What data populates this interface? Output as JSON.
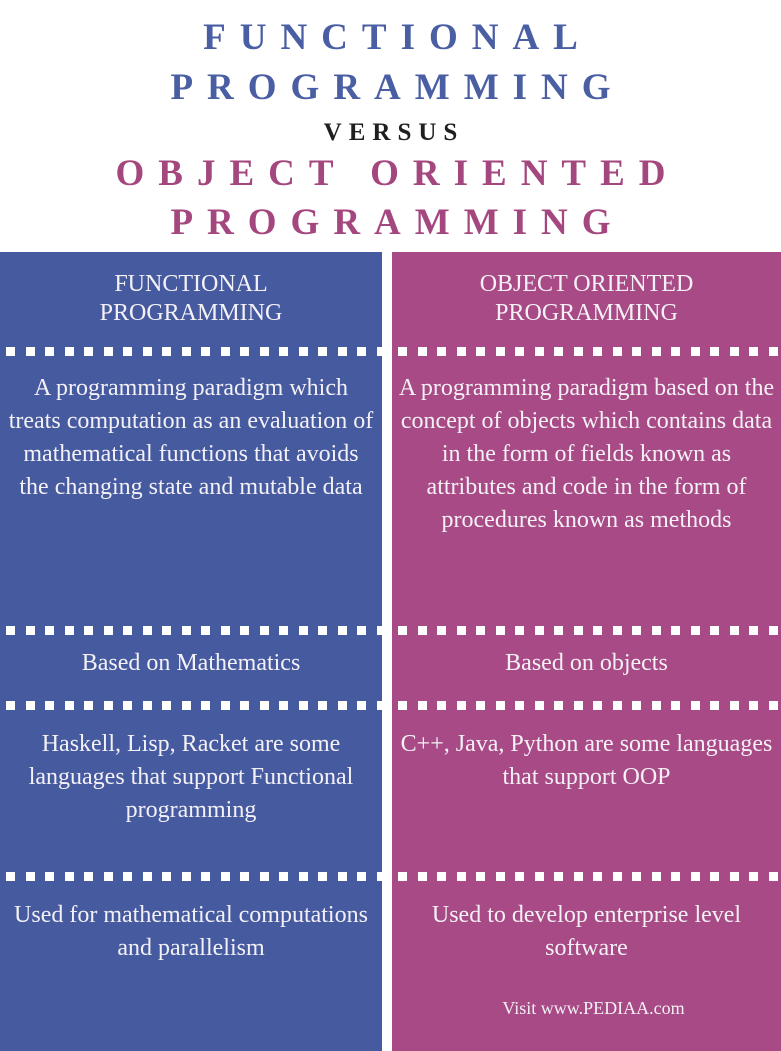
{
  "title": {
    "line1": "FUNCTIONAL",
    "line2": "PROGRAMMING",
    "versus": "VERSUS",
    "line3": "OBJECT ORIENTED",
    "line4": "PROGRAMMING"
  },
  "colors": {
    "functional": "#465aa0",
    "object_oriented": "#a84a85",
    "versus": "#1f1f1f"
  },
  "columns": {
    "functional": {
      "header": "FUNCTIONAL PROGRAMMING",
      "definition": "A programming paradigm which treats computation as an evaluation of mathematical functions that avoids the changing state and mutable data",
      "basis": "Based on Mathematics",
      "languages": "Haskell, Lisp, Racket are some languages that support Functional programming",
      "usage": "Used for mathematical computations and parallelism"
    },
    "object_oriented": {
      "header": "OBJECT ORIENTED PROGRAMMING",
      "definition": "A programming paradigm based on the concept of objects which contains data in the form of fields known as attributes and code in the form of procedures known as methods",
      "basis": "Based on objects",
      "languages": "C++, Java, Python are some languages that support OOP",
      "usage": "Used to develop enterprise level software"
    }
  },
  "footer": {
    "credit": "Visit www.PEDIAA.com"
  }
}
